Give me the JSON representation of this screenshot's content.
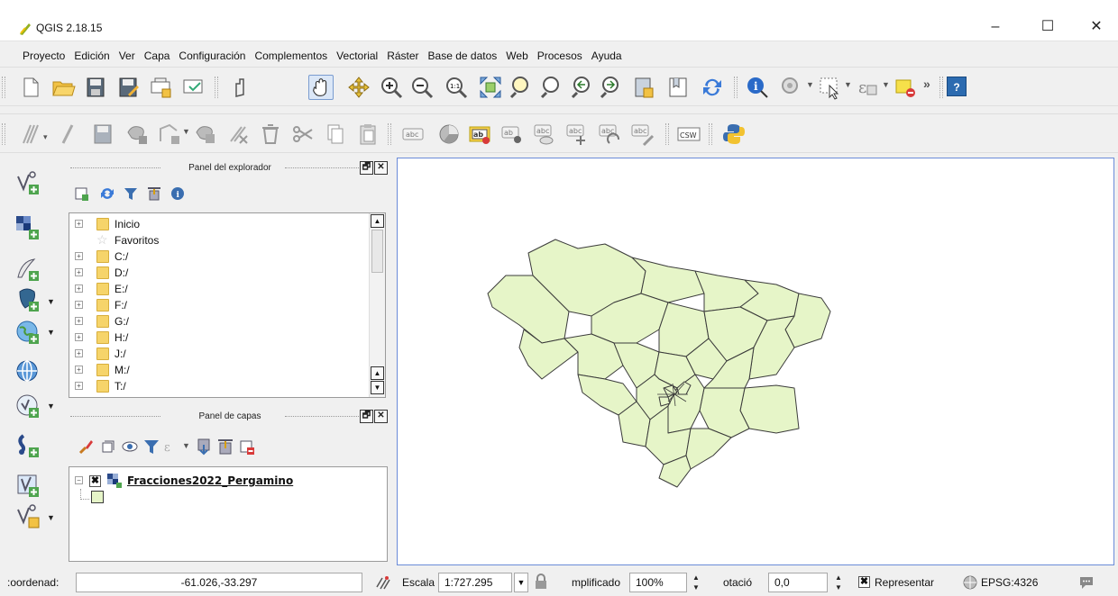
{
  "window": {
    "title": "QGIS 2.18.15",
    "minimize_glyph": "–",
    "maximize_glyph": "☐",
    "close_glyph": "✕"
  },
  "menubar": {
    "items": [
      "Proyecto",
      "Edición",
      "Ver",
      "Capa",
      "Configuración",
      "Complementos",
      "Vectorial",
      "Ráster",
      "Base de datos",
      "Web",
      "Procesos",
      "Ayuda"
    ]
  },
  "toolbar_overflow": "»",
  "toolbar_help": "?",
  "label_icons": {
    "abc": "abc",
    "csw": "CSW"
  },
  "browser_panel": {
    "title": "Panel del explorador",
    "float_glyph": "🗗",
    "close_glyph": "✕",
    "items": [
      {
        "label": "Inicio",
        "kind": "folder"
      },
      {
        "label": "Favoritos",
        "kind": "favorites"
      },
      {
        "label": "C:/",
        "kind": "folder"
      },
      {
        "label": "D:/",
        "kind": "folder"
      },
      {
        "label": "E:/",
        "kind": "folder"
      },
      {
        "label": "F:/",
        "kind": "folder"
      },
      {
        "label": "G:/",
        "kind": "folder"
      },
      {
        "label": "H:/",
        "kind": "folder"
      },
      {
        "label": "J:/",
        "kind": "folder"
      },
      {
        "label": "M:/",
        "kind": "folder"
      },
      {
        "label": "T:/",
        "kind": "folder"
      }
    ]
  },
  "layers_panel": {
    "title": "Panel de capas",
    "layers": [
      {
        "name": "Fracciones2022_Pergamino",
        "visible": true,
        "fill_color": "#e6f5c8"
      }
    ]
  },
  "statusbar": {
    "coord_label": ":oordenad:",
    "coord_value": "-61.026,-33.297",
    "scale_label": "Escala",
    "scale_value": "1:727.295",
    "magnifier_label": "mplificado",
    "magnifier_value": "100%",
    "rotation_label": "otació",
    "rotation_value": "0,0",
    "render_label": "Representar",
    "render_checked": true,
    "crs_label": "EPSG:4326"
  },
  "colors": {
    "polygon_fill": "#e6f5c8",
    "polygon_stroke": "#3b3b3b",
    "canvas_border": "#6a8bd8"
  }
}
